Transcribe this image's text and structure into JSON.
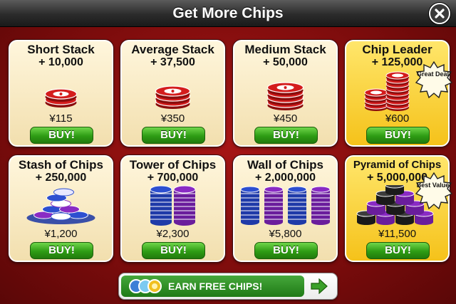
{
  "header": {
    "title": "Get More Chips"
  },
  "packages": [
    {
      "name": "Short Stack",
      "amount": "+ 10,000",
      "price": "¥115",
      "buy": "BUY!",
      "badge": ""
    },
    {
      "name": "Average Stack",
      "amount": "+ 37,500",
      "price": "¥350",
      "buy": "BUY!",
      "badge": ""
    },
    {
      "name": "Medium Stack",
      "amount": "+ 50,000",
      "price": "¥450",
      "buy": "BUY!",
      "badge": ""
    },
    {
      "name": "Chip Leader",
      "amount": "+ 125,000",
      "price": "¥600",
      "buy": "BUY!",
      "badge": "Great Deal!"
    },
    {
      "name": "Stash of Chips",
      "amount": "+ 250,000",
      "price": "¥1,200",
      "buy": "BUY!",
      "badge": ""
    },
    {
      "name": "Tower of Chips",
      "amount": "+ 700,000",
      "price": "¥2,300",
      "buy": "BUY!",
      "badge": ""
    },
    {
      "name": "Wall of Chips",
      "amount": "+ 2,000,000",
      "price": "¥5,800",
      "buy": "BUY!",
      "badge": ""
    },
    {
      "name": "Pyramid of Chips",
      "amount": "+ 5,000,000",
      "price": "¥11,500",
      "buy": "BUY!",
      "badge": "Best Value!"
    }
  ],
  "earn": {
    "label": "EARN FREE CHIPS!"
  },
  "colors": {
    "felt": "#a81616",
    "buy_green": "#2e9c14",
    "gold_card": "#f5c21a",
    "chip_red": "#d41c1c",
    "chip_blue": "#2d4fd0",
    "chip_purple": "#8a2bc4",
    "chip_black": "#2a2a2a"
  }
}
